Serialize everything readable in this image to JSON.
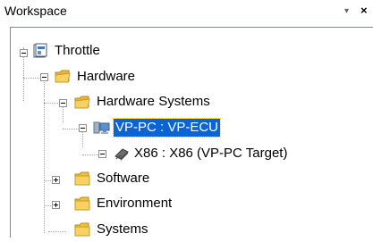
{
  "window": {
    "title": "Workspace",
    "pin_glyph": "▾",
    "close_glyph": "×"
  },
  "tree": {
    "root": {
      "label": "Throttle",
      "icon": "project-icon"
    },
    "hardware": {
      "label": "Hardware",
      "icon": "folder-icon"
    },
    "hardware_systems": {
      "label": "Hardware Systems",
      "icon": "folder-icon"
    },
    "vp_pc": {
      "label": "VP-PC : VP-ECU",
      "icon": "computer-icon",
      "selected": true
    },
    "x86": {
      "label": "X86 : X86 (VP-PC Target)",
      "icon": "chip-icon"
    },
    "software": {
      "label": "Software",
      "icon": "folder-icon"
    },
    "environment": {
      "label": "Environment",
      "icon": "folder-icon"
    },
    "systems": {
      "label": "Systems",
      "icon": "folder-icon"
    }
  },
  "colors": {
    "selection": "#0a64d8",
    "folder": "#f5c542"
  }
}
